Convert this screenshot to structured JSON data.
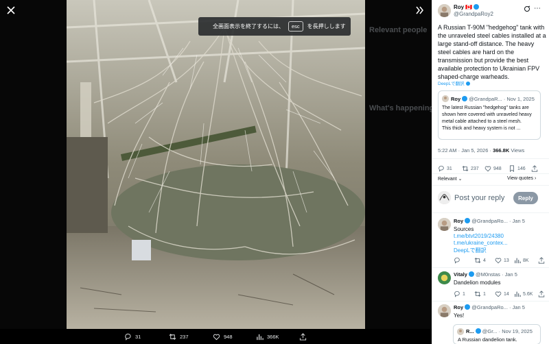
{
  "overlay": {
    "esc_hint_before": "全画面表示を終了するには、",
    "esc_key": "esc",
    "esc_hint_after": "を長押しします"
  },
  "background_page": {
    "relevant_people": "Relevant people",
    "whats_happening": "What's happening"
  },
  "action_bar": {
    "replies": "31",
    "reposts": "237",
    "likes": "948",
    "views": "366K"
  },
  "tweet": {
    "author_name": "Roy",
    "author_flag": "🇨🇦",
    "author_handle": "@GrandpaRoy2",
    "text": "A Russian T-90M \"hedgehog\" tank with the unraveled steel cables installed at a large stand-off distance. The heavy steel cables are hard on the transmission but provide the best available protection to Ukrainian FPV shaped-charge warheads.",
    "translate_label": "DeepLで翻訳",
    "quote": {
      "author_name": "Roy",
      "author_handle": "@GrandpaR...",
      "date": "Nov 1, 2025",
      "text": "The latest Russian \"hedgehog\" tanks are shown here covered with unraveled heavy metal cable attached to a steel mesh.\nThis thick and heavy system is not ..."
    },
    "time": "5:22 AM",
    "date": "Jan 5, 2026",
    "views_count": "366.8K",
    "views_label": "Views",
    "stats": {
      "replies": "31",
      "reposts": "237",
      "likes": "948",
      "bookmarks": "146"
    },
    "sort_label": "Relevant",
    "view_quotes": "View quotes"
  },
  "reply_box": {
    "placeholder": "Post your reply",
    "button": "Reply"
  },
  "replies": [
    {
      "name": "Roy",
      "handle": "@GrandpaRo...",
      "date": "Jan 5",
      "text": "Sources",
      "link1": "t.me/btvt2019/24380",
      "link2": "t.me/ukraine_contex...",
      "translate": "DeepLで翻訳",
      "stats": {
        "replies": "",
        "reposts": "4",
        "likes": "13",
        "views": "8K"
      }
    },
    {
      "name": "Vitaly",
      "handle": "@M0nstas",
      "date": "Jan 5",
      "text": "Dandelion modules",
      "stats": {
        "replies": "1",
        "reposts": "1",
        "likes": "14",
        "views": "5.6K"
      }
    },
    {
      "name": "Roy",
      "handle": "@GrandpaRo...",
      "date": "Jan 5",
      "text": "Yes!",
      "quote": {
        "name": "R...",
        "handle": "@Gr...",
        "date": "Nov 19, 2025",
        "text": "A Russian dandelion tank."
      }
    }
  ],
  "colors": {
    "accent": "#1d9bf0",
    "muted": "#536471",
    "verified": "#1d9bf0"
  },
  "icons": [
    "close-icon",
    "expand-icon",
    "reply-icon",
    "repost-icon",
    "like-icon",
    "views-icon",
    "bookmark-icon",
    "share-icon",
    "verified-icon",
    "grok-icon",
    "more-icon"
  ]
}
